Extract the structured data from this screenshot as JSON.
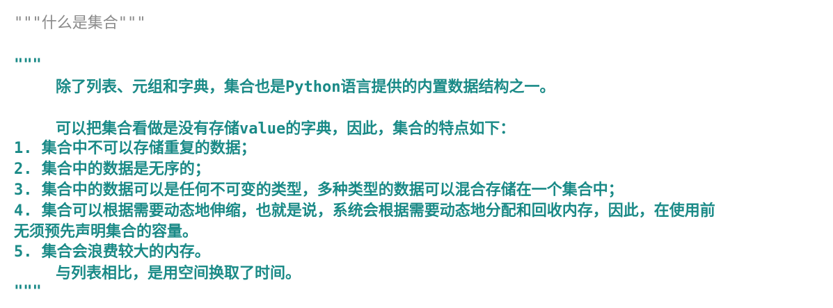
{
  "code": {
    "comment_line": "\"\"\"什么是集合\"\"\"",
    "docstring_open": "\"\"\"",
    "intro": "除了列表、元组和字典，集合也是Python语言提供的内置数据结构之一。",
    "description": "可以把集合看做是没有存储value的字典，因此，集合的特点如下：",
    "item1": "1. 集合中不可以存储重复的数据；",
    "item2": "2. 集合中的数据是无序的；",
    "item3": "3. 集合中的数据可以是任何不可变的类型，多种类型的数据可以混合存储在一个集合中；",
    "item4_a": "4. 集合可以根据需要动态地伸缩，也就是说，系统会根据需要动态地分配和回收内存，因此，在使用前",
    "item4_b": "无须预先声明集合的容量。",
    "item5": "5. 集合会浪费较大的内存。",
    "item5_detail": "与列表相比，是用空间换取了时间。",
    "docstring_close": "\"\"\""
  },
  "colors": {
    "docstring_text": "#1a8a87",
    "comment_text": "#8a8a8a",
    "background": "#ffffff"
  }
}
